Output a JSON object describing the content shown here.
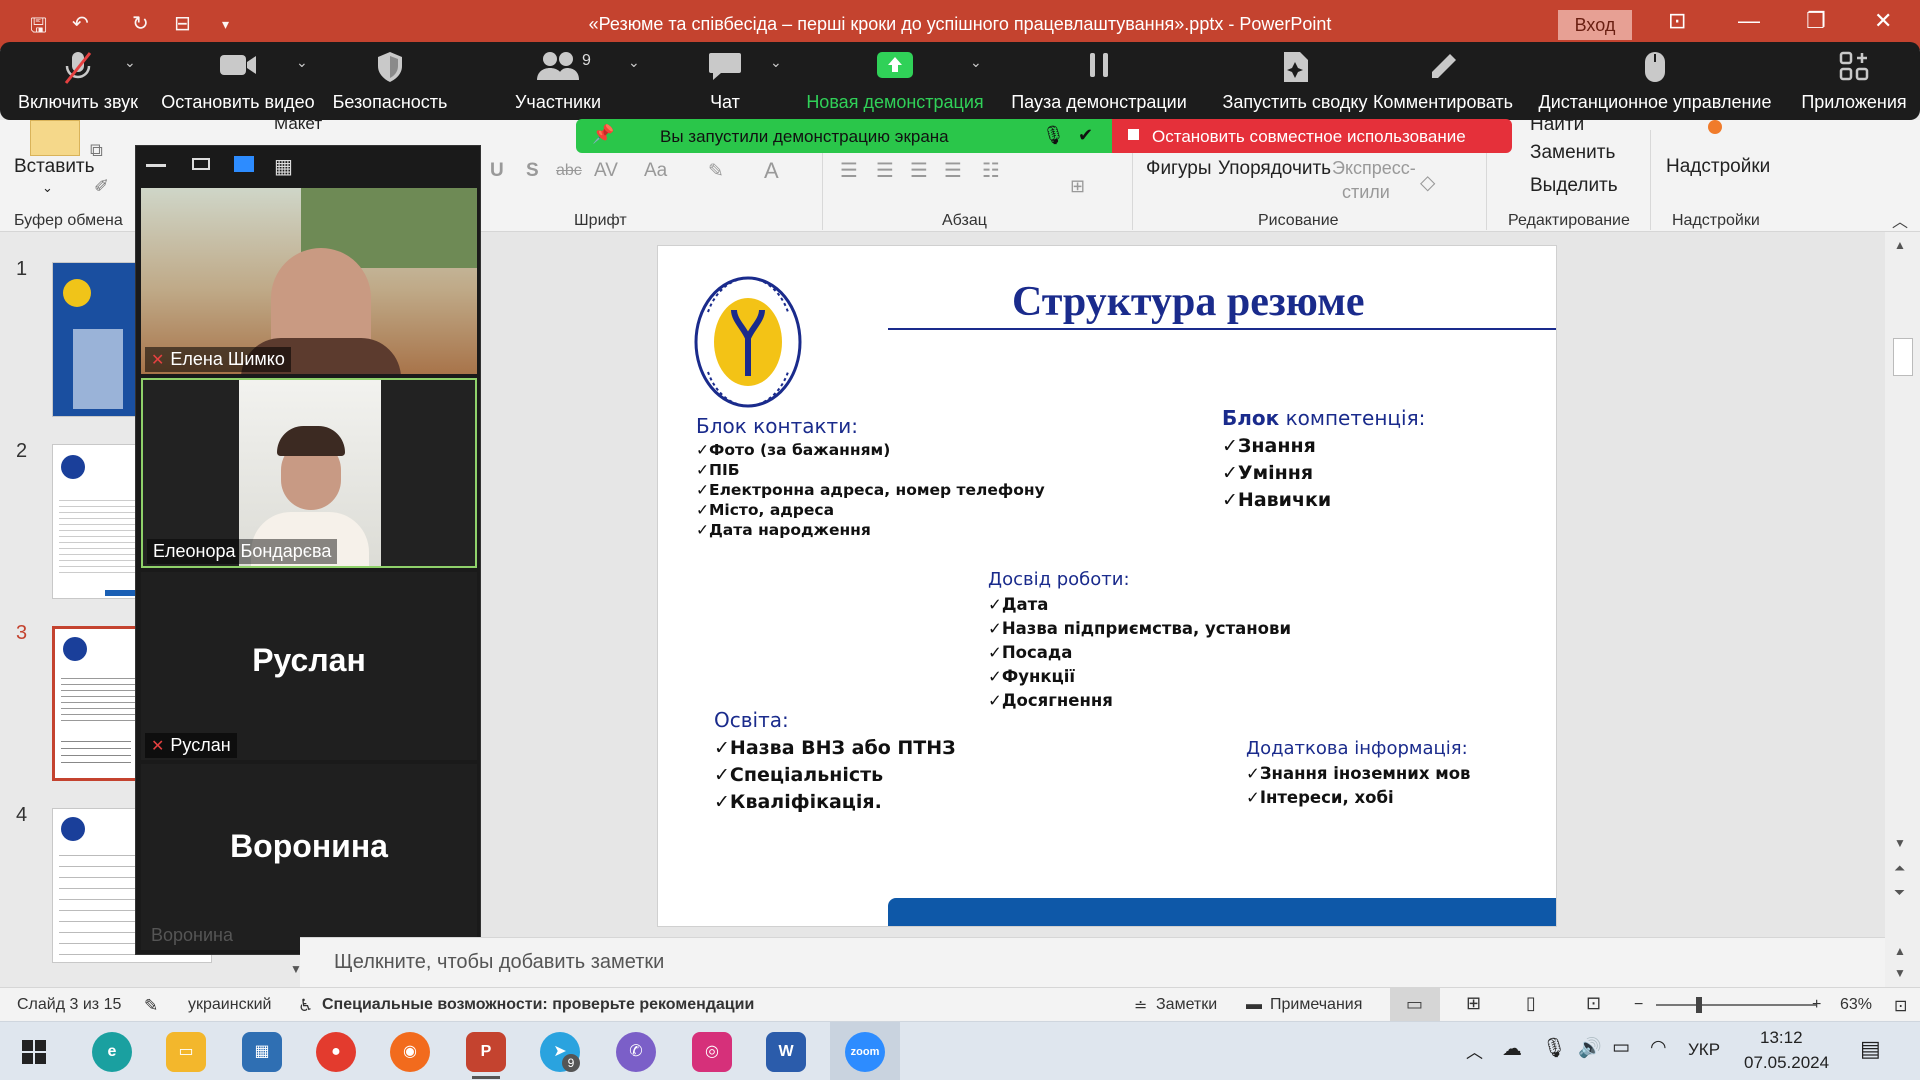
{
  "window": {
    "title": "«Резюме та співбесіда – перші кроки до успішного працевлаштування».pptx  -  PowerPoint",
    "login_label": "Вход"
  },
  "zoom_toolbar": {
    "items": [
      {
        "label": "Включить звук",
        "icon": "mic-off-icon"
      },
      {
        "label": "Остановить видео",
        "icon": "video-camera-icon"
      },
      {
        "label": "Безопасность",
        "icon": "shield-icon"
      },
      {
        "label": "Участники",
        "icon": "participants-icon",
        "count": "9"
      },
      {
        "label": "Чат",
        "icon": "chat-icon"
      },
      {
        "label": "Новая демонстрация",
        "icon": "share-screen-icon"
      },
      {
        "label": "Пауза демонстрации",
        "icon": "pause-icon"
      },
      {
        "label": "Запустить сводку",
        "icon": "summary-icon"
      },
      {
        "label": "Комментировать",
        "icon": "pen-icon"
      },
      {
        "label": "Дистанционное управление",
        "icon": "mouse-icon"
      },
      {
        "label": "Приложения",
        "icon": "apps-icon"
      }
    ],
    "share_notice": "Вы запустили демонстрацию экрана",
    "stop_share": "Остановить совместное использование"
  },
  "ribbon": {
    "paste": "Вставить",
    "layout": "Макет",
    "groups": [
      "Буфер обмена",
      "Шрифт",
      "Абзац",
      "Рисование",
      "Редактирование",
      "Надстройки"
    ],
    "find": "Найти",
    "replace": "Заменить",
    "select": "Выделить",
    "addins": "Надстройки",
    "shapes": "Фигуры",
    "arrange": "Упорядочить",
    "quick_styles_1": "Экспресс-",
    "quick_styles_2": "стили"
  },
  "thumbnails": [
    {
      "num": "1"
    },
    {
      "num": "2"
    },
    {
      "num": "3"
    },
    {
      "num": "4"
    }
  ],
  "participants": [
    {
      "name": "Елена Шимко"
    },
    {
      "name": "Елеонора Бондарєва"
    },
    {
      "name": "Руслан"
    },
    {
      "name": "Воронина"
    }
  ],
  "slide": {
    "title": "Структура резюме",
    "logo_text": "ДЕРЖАВНА СЛУЖБА ЗАЙНЯТОСТІ",
    "contacts_header": "Блок контакти:",
    "contacts": [
      "✓Фото (за бажанням)",
      "✓ПІБ",
      "✓Електронна адреса, номер телефону",
      "✓Місто, адреса",
      "✓Дата народження"
    ],
    "competence_bold": "Блок",
    "competence_rest": " компетенція:",
    "competence": [
      "✓Знання",
      "✓Уміння",
      "✓Навички"
    ],
    "experience_header": "Досвід роботи:",
    "experience": [
      "✓Дата",
      "✓Назва підприємства, установи",
      "✓Посада",
      "✓Функції",
      "✓Досягнення"
    ],
    "education_header": "Освіта:",
    "education": [
      "✓Назва ВНЗ або ПТНЗ",
      "✓Спеціальність",
      "✓Кваліфікація."
    ],
    "extra_header": "Додаткова інформація:",
    "extra": [
      "✓Знання іноземних мов",
      "✓Інтереси, хобі"
    ]
  },
  "notes_placeholder": "Щелкните, чтобы добавить заметки",
  "status": {
    "slide": "Слайд 3 из 15",
    "language": "украинский",
    "accessibility": "Специальные возможности: проверьте рекомендации",
    "notes": "Заметки",
    "comments": "Примечания",
    "zoom": "63%"
  },
  "taskbar": {
    "lang": "УКР",
    "time": "13:12",
    "date": "07.05.2024",
    "telegram_badge": "9"
  }
}
